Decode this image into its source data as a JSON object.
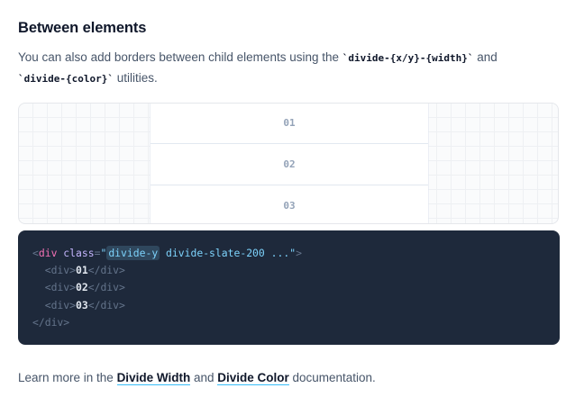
{
  "section": {
    "title": "Between elements",
    "intro": {
      "text_1": "You can also add borders between child elements using the ",
      "code_1": "`divide-{x/y}-{width}`",
      "text_2": " and ",
      "code_2": "`divide-{color}`",
      "text_3": " utilities."
    }
  },
  "preview": {
    "items": [
      "01",
      "02",
      "03"
    ]
  },
  "code_example": {
    "line1": {
      "open": "<",
      "tag": "div",
      "space": " ",
      "attr": "class",
      "eq": "=",
      "quote_open": "\"",
      "highlight": "divide-y",
      "rest": " divide-slate-200 ...",
      "quote_close": "\"",
      "close": ">"
    },
    "children": [
      {
        "open_tag": "<div>",
        "text": "01",
        "close_tag": "</div>"
      },
      {
        "open_tag": "<div>",
        "text": "02",
        "close_tag": "</div>"
      },
      {
        "open_tag": "<div>",
        "text": "03",
        "close_tag": "</div>"
      }
    ],
    "closing": "</div>"
  },
  "footer": {
    "text_1": "Learn more in the ",
    "link_1": "Divide Width",
    "text_2": " and ",
    "link_2": "Divide Color",
    "text_3": " documentation."
  }
}
